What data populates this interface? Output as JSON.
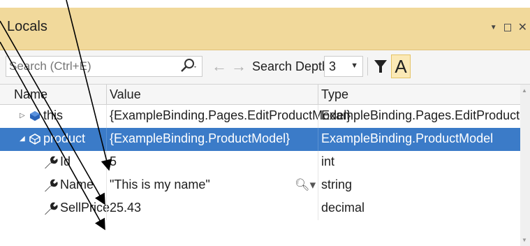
{
  "window": {
    "title": "Locals"
  },
  "toolbar": {
    "search_placeholder": "Search (Ctrl+E)",
    "search_depth_label": "Search Depth:",
    "search_depth_value": "3",
    "font_toggle_label": "A"
  },
  "grid": {
    "columns": [
      "Name",
      "Value",
      "Type"
    ],
    "rows": [
      {
        "name": "this",
        "value": "{ExampleBinding.Pages.EditProductModel}",
        "type": "ExampleBinding.Pages.EditProductModel",
        "icon": "object-icon",
        "expander": "collapsed",
        "selected": false
      },
      {
        "name": "product",
        "value": "{ExampleBinding.ProductModel}",
        "type": "ExampleBinding.ProductModel",
        "icon": "object-icon",
        "expander": "expanded",
        "selected": true
      },
      {
        "name": "Id",
        "value": "5",
        "type": "int",
        "icon": "wrench-icon",
        "selected": false
      },
      {
        "name": "Name",
        "value": "\"This is my name\"",
        "type": "string",
        "icon": "wrench-icon",
        "selected": false
      },
      {
        "name": "SellPrice",
        "value": "25.43",
        "type": "decimal",
        "icon": "wrench-icon",
        "selected": false
      }
    ]
  },
  "colors": {
    "titlebar": "#f1d99b",
    "selection": "#3b7bc8",
    "toggle_active": "#fbe9b6"
  }
}
